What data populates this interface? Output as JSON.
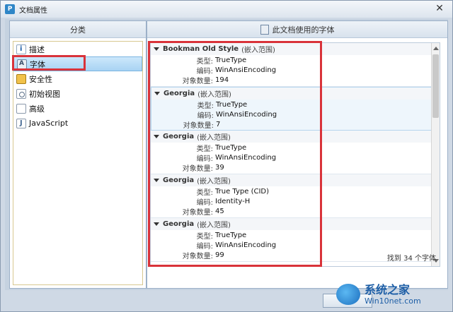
{
  "window": {
    "title": "文档属性",
    "close_glyph": "✕"
  },
  "sidebar": {
    "header": "分类",
    "items": [
      {
        "label": "描述",
        "icon": "info-icon"
      },
      {
        "label": "字体",
        "icon": "font-icon",
        "selected": true
      },
      {
        "label": "安全性",
        "icon": "lock-icon"
      },
      {
        "label": "初始视图",
        "icon": "view-icon"
      },
      {
        "label": "高级",
        "icon": "advanced-icon"
      },
      {
        "label": "JavaScript",
        "icon": "javascript-icon"
      }
    ]
  },
  "main": {
    "header": "此文档使用的字体",
    "fonts": [
      {
        "name": "Bookman Old Style",
        "embed": "(嵌入范围)",
        "type_label": "类型:",
        "type": "TrueType",
        "encoding_label": "编码:",
        "encoding": "WinAnsiEncoding",
        "count_label": "对象数量:",
        "count": "194"
      },
      {
        "name": "Georgia",
        "embed": "(嵌入范围)",
        "type_label": "类型:",
        "type": "TrueType",
        "encoding_label": "编码:",
        "encoding": "WinAnsiEncoding",
        "count_label": "对象数量:",
        "count": "7"
      },
      {
        "name": "Georgia",
        "embed": "(嵌入范围)",
        "type_label": "类型:",
        "type": "TrueType",
        "encoding_label": "编码:",
        "encoding": "WinAnsiEncoding",
        "count_label": "对象数量:",
        "count": "39"
      },
      {
        "name": "Georgia",
        "embed": "(嵌入范围)",
        "type_label": "类型:",
        "type": "True Type (CID)",
        "encoding_label": "编码:",
        "encoding": "Identity-H",
        "count_label": "对象数量:",
        "count": "45"
      },
      {
        "name": "Georgia",
        "embed": "(嵌入范围)",
        "type_label": "类型:",
        "type": "TrueType",
        "encoding_label": "编码:",
        "encoding": "WinAnsiEncoding",
        "count_label": "对象数量:",
        "count": "99"
      }
    ],
    "found_text": "找到 34 个字体"
  },
  "watermark": {
    "cn": "系统之家",
    "url": "Win10net.com"
  },
  "colors": {
    "highlight": "#d9333a",
    "selection": "#a8d3f3"
  }
}
